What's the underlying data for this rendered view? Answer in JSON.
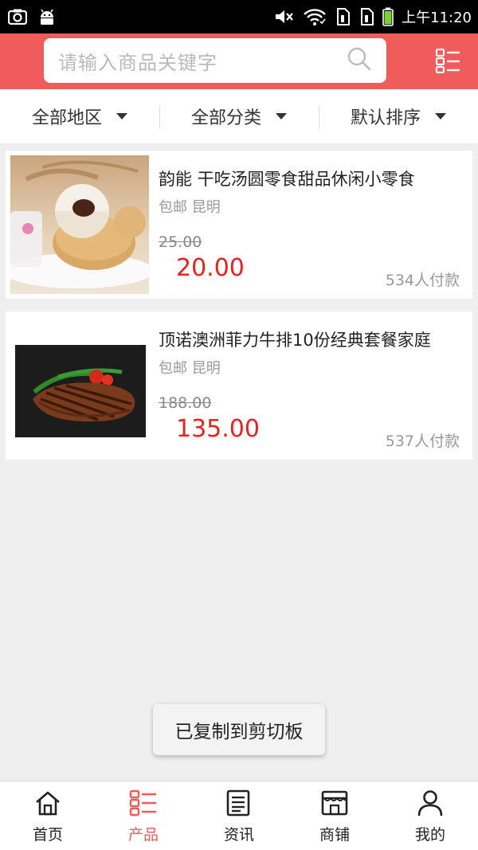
{
  "status_bar": {
    "time": "上午11:20",
    "left_icons": [
      "screenshot-icon",
      "android-icon"
    ],
    "right_icons": [
      "mute-icon",
      "wifi-icon",
      "sim1-icon",
      "sim2-icon",
      "battery-icon"
    ]
  },
  "header": {
    "search_placeholder": "请输入商品关键字",
    "accent_color": "#f05b5b"
  },
  "filters": [
    {
      "label": "全部地区"
    },
    {
      "label": "全部分类"
    },
    {
      "label": "默认排序"
    }
  ],
  "products": [
    {
      "title": "韵能 干吃汤圆零食甜品休闲小零食",
      "tags": "包邮 昆明",
      "original_price": "25.00",
      "price": "20.00",
      "sold": "534人付款"
    },
    {
      "title": "顶诺澳洲菲力牛排10份经典套餐家庭",
      "tags": "包邮 昆明",
      "original_price": "188.00",
      "price": "135.00",
      "sold": "537人付款"
    }
  ],
  "toast": "已复制到剪切板",
  "bottom_nav": [
    {
      "label": "首页",
      "icon": "home-icon",
      "active": false
    },
    {
      "label": "产品",
      "icon": "product-list-icon",
      "active": true
    },
    {
      "label": "资讯",
      "icon": "news-icon",
      "active": false
    },
    {
      "label": "商铺",
      "icon": "shop-icon",
      "active": false
    },
    {
      "label": "我的",
      "icon": "user-icon",
      "active": false
    }
  ],
  "colors": {
    "price_red": "#e8221f",
    "nav_active": "#f05b5b",
    "background": "#efefef"
  }
}
